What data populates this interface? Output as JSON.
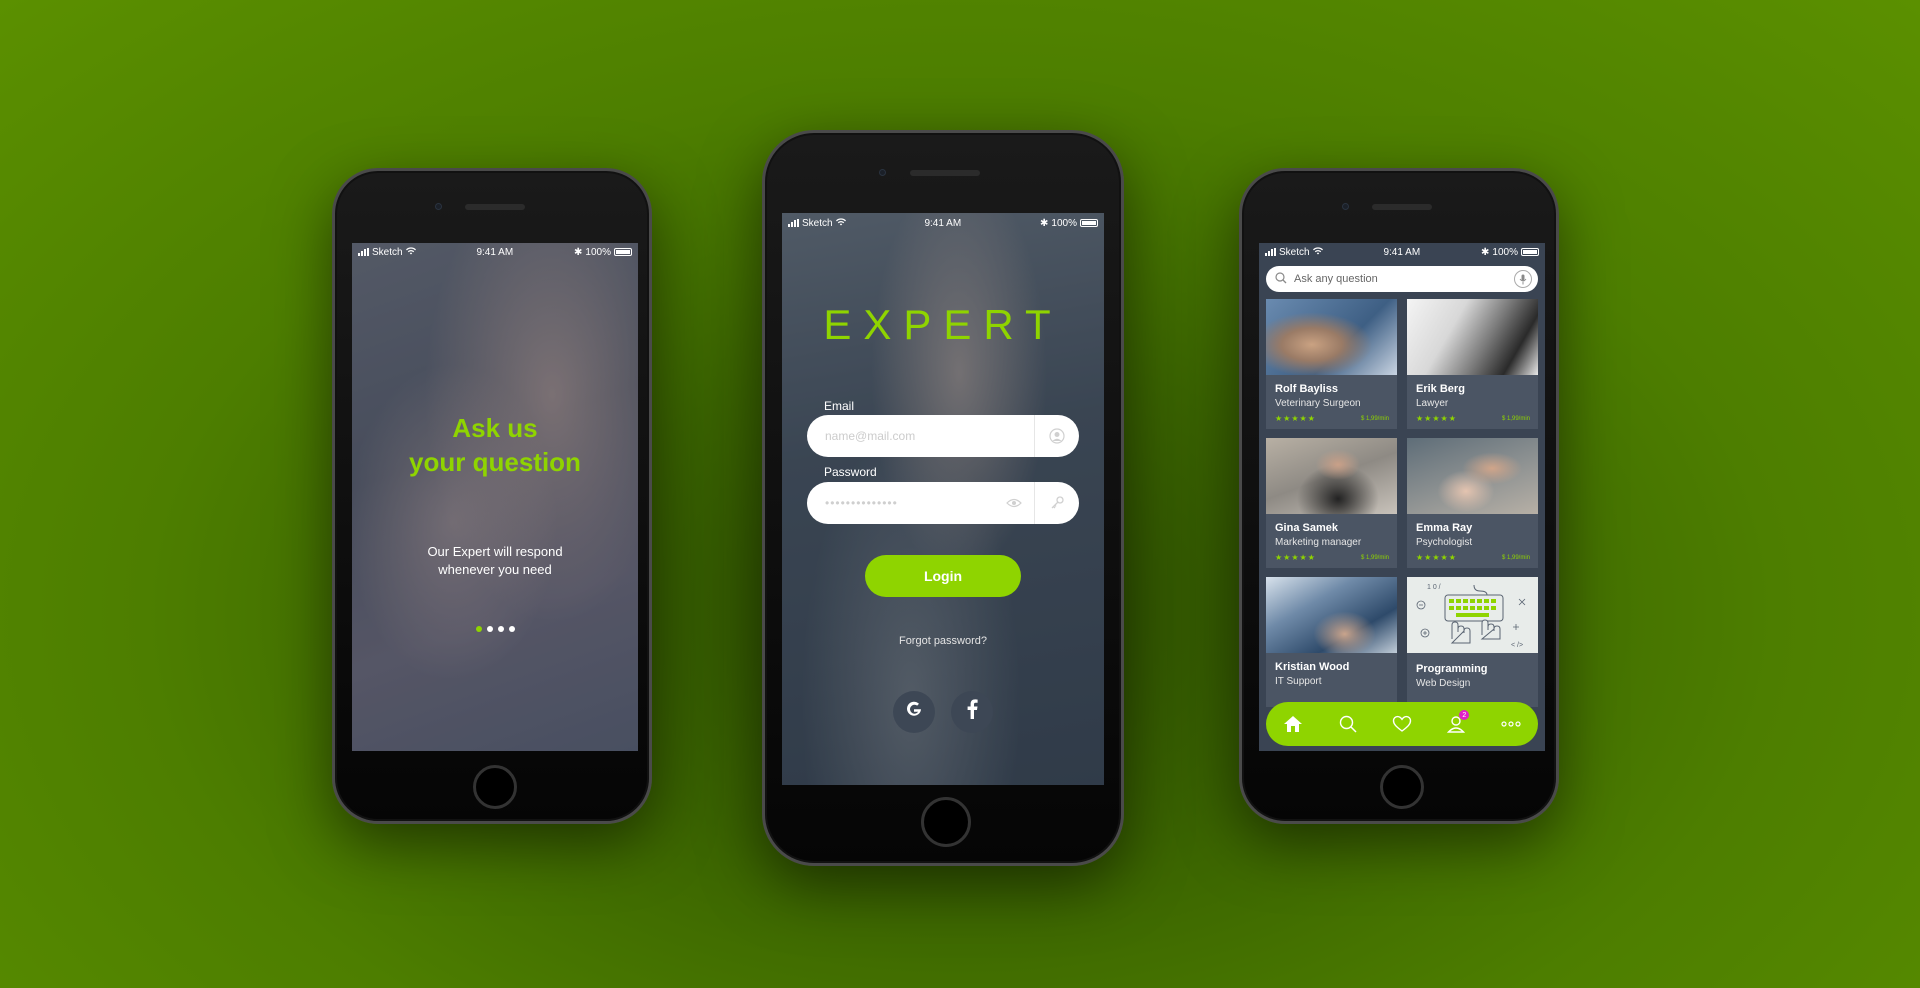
{
  "status_bar": {
    "carrier": "Sketch",
    "time": "9:41 AM",
    "battery": "100%"
  },
  "onboarding": {
    "title_line1": "Ask us",
    "title_line2": "your question",
    "subtitle_line1": "Our Expert will respond",
    "subtitle_line2": "whenever you need",
    "page_count": 4,
    "active_page": 1
  },
  "login": {
    "brand": "EXPERT",
    "email_label": "Email",
    "email_placeholder": "name@mail.com",
    "password_label": "Password",
    "password_value": "••••••••••••••",
    "login_button": "Login",
    "forgot_password": "Forgot password?",
    "social": [
      "google",
      "facebook"
    ]
  },
  "experts": {
    "search_placeholder": "Ask any question",
    "cards": [
      {
        "name": "Rolf Bayliss",
        "role": "Veterinary Surgeon",
        "stars": "★★★★★",
        "price": "$ 1,99/min"
      },
      {
        "name": "Erik Berg",
        "role": "Lawyer",
        "stars": "★★★★★",
        "price": "$ 1,99/min"
      },
      {
        "name": "Gina Samek",
        "role": "Marketing manager",
        "stars": "★★★★★",
        "price": "$ 1,99/min"
      },
      {
        "name": "Emma Ray",
        "role": "Psychologist",
        "stars": "★★★★★",
        "price": "$ 1,99/min"
      },
      {
        "name": "Kristian Wood",
        "role": "IT Support"
      },
      {
        "name": "Programming",
        "role": "Web Design"
      }
    ],
    "tabs": [
      "home",
      "search",
      "favorites",
      "profile",
      "more"
    ],
    "profile_badge": "2"
  },
  "colors": {
    "accent": "#8fd400",
    "card_bg": "#4b5564",
    "screen_bg": "#3a4453",
    "badge": "#e020c8"
  }
}
